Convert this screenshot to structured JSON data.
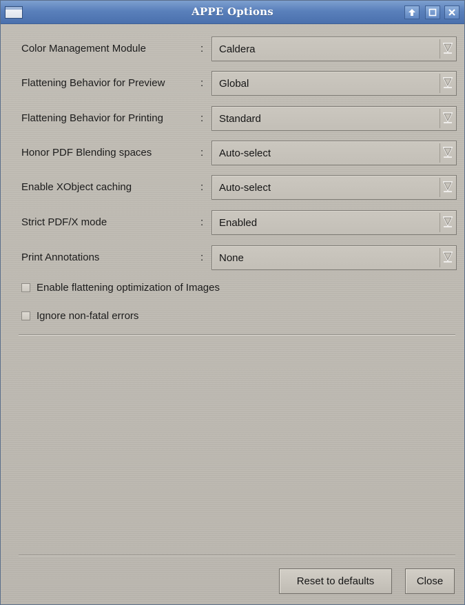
{
  "window": {
    "title": "APPE Options"
  },
  "options": [
    {
      "label": "Color Management Module",
      "value": "Caldera"
    },
    {
      "label": "Flattening Behavior for Preview",
      "value": "Global"
    },
    {
      "label": "Flattening Behavior for Printing",
      "value": "Standard"
    },
    {
      "label": "Honor PDF Blending spaces",
      "value": "Auto-select"
    },
    {
      "label": "Enable XObject caching",
      "value": "Auto-select"
    },
    {
      "label": "Strict PDF/X mode",
      "value": "Enabled"
    },
    {
      "label": "Print Annotations",
      "value": "None"
    }
  ],
  "colon": ":",
  "checkboxes": [
    {
      "label": "Enable flattening optimization of Images",
      "checked": false
    },
    {
      "label": "Ignore non-fatal errors",
      "checked": false
    }
  ],
  "buttons": {
    "reset_label": "Reset to defaults",
    "close_label": "Close"
  },
  "icons": {
    "system_menu": "window-menu-icon",
    "shade": "up-arrow-icon",
    "maximize": "maximize-icon",
    "close": "close-icon",
    "combo_arrow": "chevron-down-icon"
  },
  "colors": {
    "titlebar": "#5a80bb",
    "window_bg": "#bdb9b1"
  }
}
